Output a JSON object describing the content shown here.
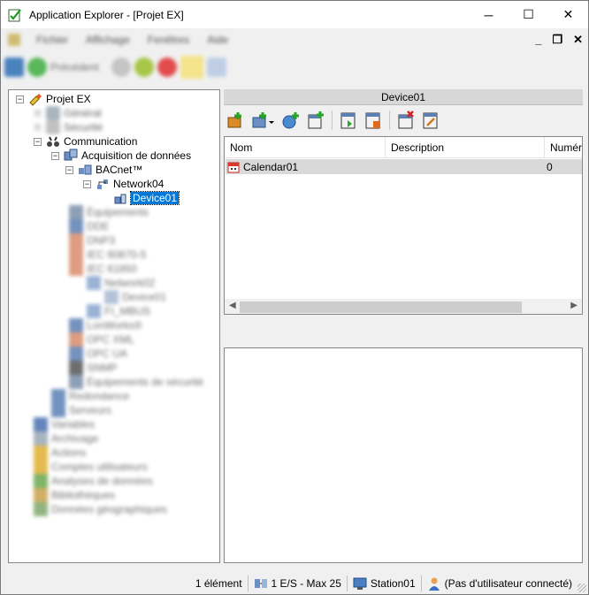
{
  "window": {
    "title": "Application Explorer - [Projet EX]",
    "controls": {
      "minimize": "─",
      "maximize": "☐",
      "close": "✕"
    }
  },
  "menu": {
    "items": [
      "Fichier",
      "Affichage",
      "Fenêtres",
      "Aide"
    ],
    "mdi_controls": {
      "minimize": "_",
      "restore": "❐",
      "close": "✕"
    }
  },
  "toolbar": {
    "back_label": "Précédent"
  },
  "tree": {
    "root": "Projet EX",
    "nodes": {
      "general": "Général",
      "security": "Sécurité",
      "communication": "Communication",
      "acquisition": "Acquisition de données",
      "bacnet": "BACnet™",
      "network": "Network04",
      "device": "Device01",
      "equipment": "Équipements",
      "dde": "DDE",
      "dnp3": "DNP3",
      "iec60870": "IEC 60870-5",
      "iec61850": "IEC 61850",
      "network02": "Network02",
      "device01b": "Device01",
      "fi_mbus": "FI_MBUS",
      "lonworks": "LonWorks®",
      "opcxml": "OPC XML",
      "opcua": "OPC UA",
      "snmp": "SNMP",
      "secu_equip": "Équipements de sécurité",
      "redundancy": "Redondance",
      "services": "Serveurs",
      "variables": "Variables",
      "archiving": "Archivage",
      "actions": "Actions",
      "user_accounts": "Comptes utilisateurs",
      "data_analysis": "Analyses de données",
      "libraries": "Bibliothèques",
      "geo_data": "Données géographiques"
    }
  },
  "device_panel": {
    "title": "Device01",
    "columns": [
      "Nom",
      "Description",
      "Numéro"
    ],
    "rows": [
      {
        "name": "Calendar01",
        "description": "",
        "number": "0"
      }
    ]
  },
  "status": {
    "count": "1 élément",
    "io": "1 E/S - Max 25",
    "station": "Station01",
    "user": "(Pas d'utilisateur connecté)"
  },
  "colors": {
    "selection": "#0078d7",
    "row_highlight": "#d9d9d9",
    "panel_header": "#d7d7d7"
  }
}
